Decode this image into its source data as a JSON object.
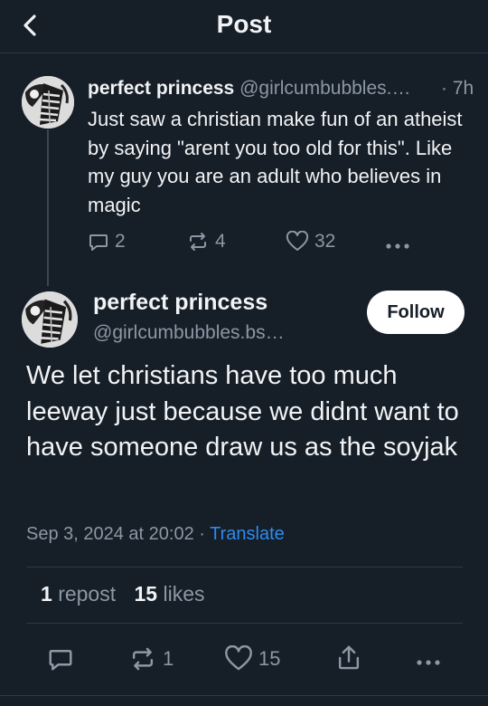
{
  "header": {
    "title": "Post"
  },
  "parent": {
    "name": "perfect princess",
    "handle": "@girlcumbubbles.…",
    "time": "· 7h",
    "text": "Just saw a christian make fun of an atheist by saying \"arent you too old for this\". Like my guy you are an adult who believes in magic",
    "replies": "2",
    "reposts": "4",
    "likes": "32"
  },
  "main": {
    "name": "perfect princess",
    "handle": "@girlcumbubbles.bs…",
    "follow_label": "Follow",
    "text": "We let christians have too much leeway just because we didnt want to have someone draw us as the soyjak",
    "date": "Sep 3, 2024 at 20:02",
    "date_sep": " · ",
    "translate_label": "Translate",
    "repost_count": "1",
    "repost_label": "repost",
    "like_count": "15",
    "like_label": "likes",
    "action_reposts": "1",
    "action_likes": "15"
  },
  "colors": {
    "background": "#161e27",
    "text": "#f1f3f5",
    "muted": "#8b98a5",
    "link": "#2d8cf0",
    "divider": "#2e3a47"
  },
  "icons": [
    "back-chevron-icon",
    "reply-icon",
    "repost-icon",
    "heart-icon",
    "share-icon",
    "more-dots-icon"
  ]
}
